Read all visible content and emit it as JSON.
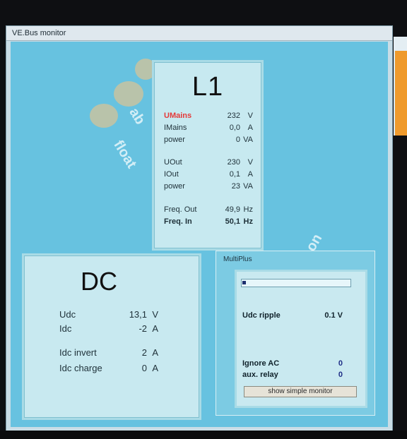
{
  "window": {
    "title": "VE.Bus monitor"
  },
  "decoration": {
    "float_text": "float",
    "ab_text": "ab",
    "on_text": "on"
  },
  "l1": {
    "title": "L1",
    "rows": [
      {
        "label": "UMains",
        "value": "232",
        "unit": "V"
      },
      {
        "label": "IMains",
        "value": "0,0",
        "unit": "A"
      },
      {
        "label": "power",
        "value": "0",
        "unit": "VA"
      },
      {
        "label": "UOut",
        "value": "230",
        "unit": "V"
      },
      {
        "label": "IOut",
        "value": "0,1",
        "unit": "A"
      },
      {
        "label": "power",
        "value": "23",
        "unit": "VA"
      },
      {
        "label": "Freq. Out",
        "value": "49,9",
        "unit": "Hz"
      },
      {
        "label": "Freq. In",
        "value": "50,1",
        "unit": "Hz"
      }
    ]
  },
  "dc": {
    "title": "DC",
    "rows": [
      {
        "label": "Udc",
        "value": "13,1",
        "unit": "V"
      },
      {
        "label": "Idc",
        "value": "-2",
        "unit": "A"
      },
      {
        "label": "Idc invert",
        "value": "2",
        "unit": "A"
      },
      {
        "label": "Idc charge",
        "value": "0",
        "unit": "A"
      }
    ]
  },
  "multiplus": {
    "title": "MultiPlus",
    "bar_fraction": 0.03,
    "udc_ripple_label": "Udc ripple",
    "udc_ripple_value": "0.1 V",
    "ignore_ac_label": "Ignore AC",
    "ignore_ac_value": "0",
    "aux_relay_label": "aux. relay",
    "aux_relay_value": "0",
    "button_label": "show simple monitor"
  },
  "colors": {
    "panel_bg": "#c7e9f0",
    "client_bg": "#67c2e0",
    "accent_red": "#e53939"
  }
}
